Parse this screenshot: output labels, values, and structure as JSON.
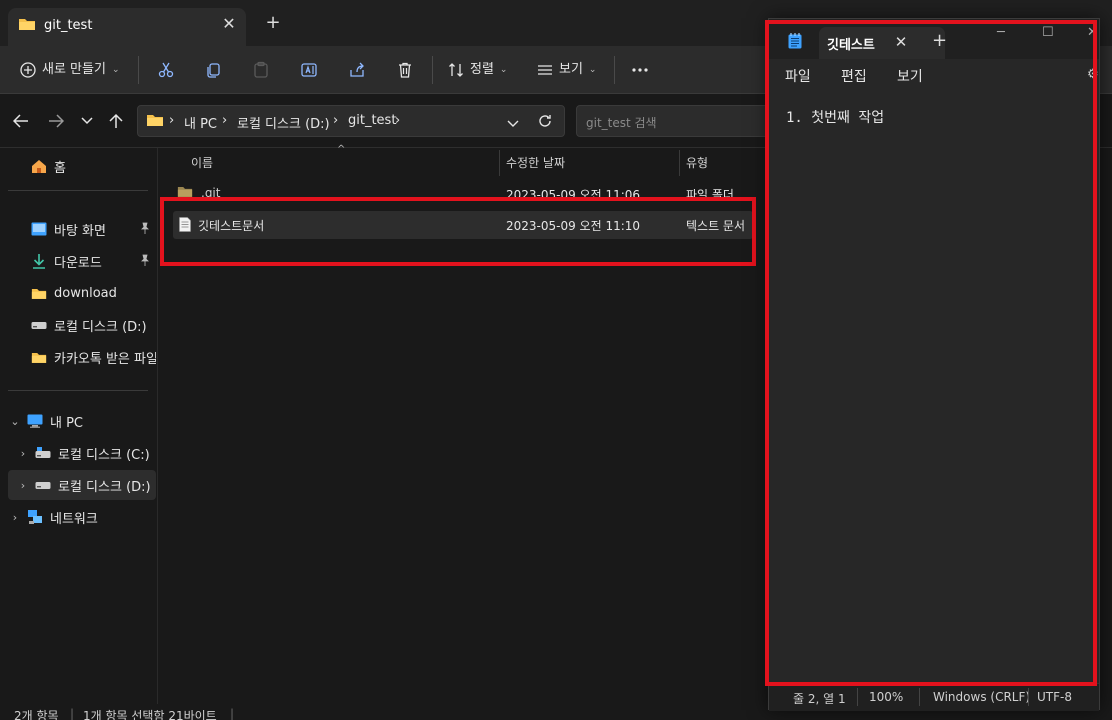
{
  "explorer": {
    "tab_title": "git_test",
    "toolbar": {
      "new_label": "새로 만들기",
      "sort_label": "정렬",
      "view_label": "보기"
    },
    "breadcrumb": [
      "내 PC",
      "로컬 디스크 (D:)",
      "git_test"
    ],
    "search_placeholder": "git_test 검색",
    "sidebar": {
      "home": "홈",
      "desktop": "바탕 화면",
      "downloads": "다운로드",
      "download_folder": "download",
      "local_d": "로컬 디스크 (D:)",
      "kakao": "카카오톡 받은 파일",
      "this_pc": "내 PC",
      "tree_c": "로컬 디스크 (C:)",
      "tree_d": "로컬 디스크 (D:)",
      "network": "네트워크"
    },
    "columns": {
      "name": "이름",
      "modified": "수정한 날짜",
      "type": "유형"
    },
    "files": [
      {
        "name": ".git",
        "modified": "2023-05-09 오전 11:06",
        "type": "파일 폴더"
      },
      {
        "name": "깃테스트문서",
        "modified": "2023-05-09 오전 11:10",
        "type": "텍스트 문서"
      }
    ],
    "status": {
      "count": "2개 항목",
      "selection": "1개 항목 선택함 21바이트"
    }
  },
  "notepad": {
    "tab_title": "깃테스트",
    "menu": [
      "파일",
      "편집",
      "보기"
    ],
    "content": "1. 첫번째 작업",
    "status": {
      "position": "줄 2, 열 1",
      "zoom": "100%",
      "line_ending": "Windows (CRLF)",
      "encoding": "UTF-8"
    }
  },
  "colors": {
    "highlight": "#e3121d",
    "folder": "#f4c04b",
    "accent": "#4aa3ff"
  }
}
